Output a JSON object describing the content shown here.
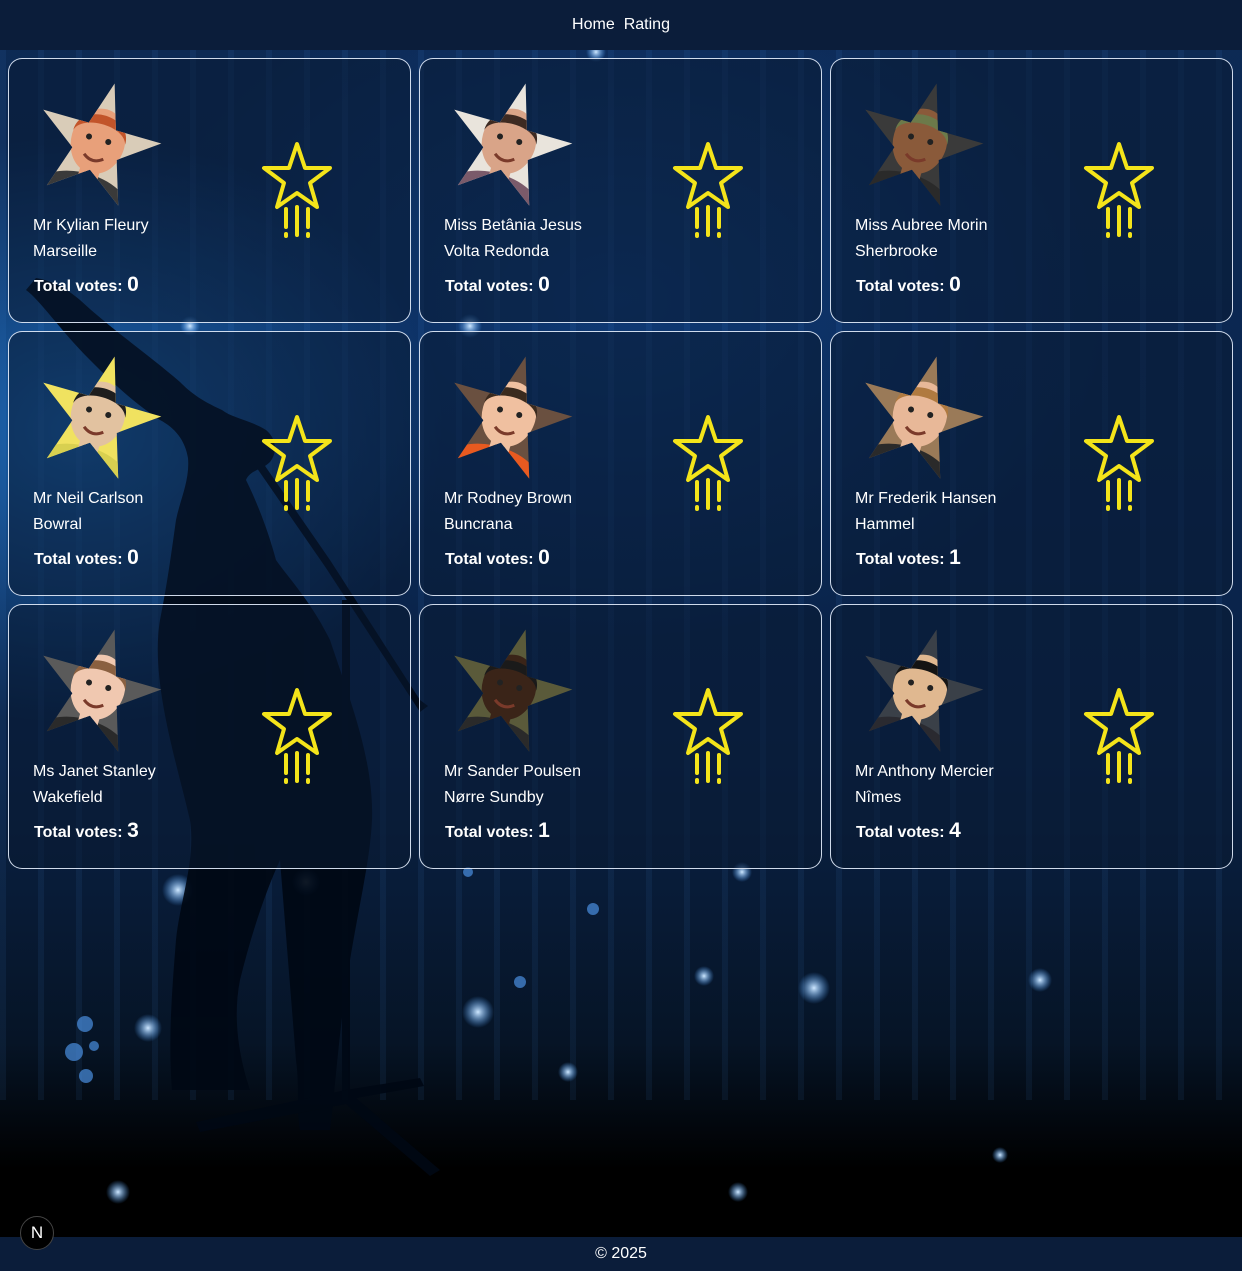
{
  "nav": {
    "home_label": "Home",
    "rating_label": "Rating"
  },
  "cards": [
    {
      "name": "Mr Kylian Fleury",
      "city": "Marseille",
      "votes_label": "Total votes:",
      "votes": "0",
      "avatar": {
        "bg": "#d9ccb8",
        "skin": "#e8a07a",
        "hair": "#c2542a",
        "shirt": "#3a3a3a"
      }
    },
    {
      "name": "Miss Betânia Jesus",
      "city": "Volta Redonda",
      "votes_label": "Total votes:",
      "votes": "0",
      "avatar": {
        "bg": "#e9e4dc",
        "skin": "#d9a488",
        "hair": "#3d2a22",
        "shirt": "#7a5a6a"
      }
    },
    {
      "name": "Miss Aubree Morin",
      "city": "Sherbrooke",
      "votes_label": "Total votes:",
      "votes": "0",
      "avatar": {
        "bg": "#3a3a3a",
        "skin": "#8a5a3a",
        "hair": "#6c7a4a",
        "shirt": "#2a2a2a"
      }
    },
    {
      "name": "Mr Neil Carlson",
      "city": "Bowral",
      "votes_label": "Total votes:",
      "votes": "0",
      "avatar": {
        "bg": "#f0e260",
        "skin": "#e2c2a0",
        "hair": "#1e1e1e",
        "shirt": "#d8d050"
      }
    },
    {
      "name": "Mr Rodney Brown",
      "city": "Buncrana",
      "votes_label": "Total votes:",
      "votes": "0",
      "avatar": {
        "bg": "#6a5040",
        "skin": "#f0c0a0",
        "hair": "#3a2a1e",
        "shirt": "#e85a20"
      }
    },
    {
      "name": "Mr Frederik Hansen",
      "city": "Hammel",
      "votes_label": "Total votes:",
      "votes": "1",
      "avatar": {
        "bg": "#9a7a58",
        "skin": "#e8b898",
        "hair": "#b07a40",
        "shirt": "#2a2a2a"
      }
    },
    {
      "name": "Ms Janet Stanley",
      "city": "Wakefield",
      "votes_label": "Total votes:",
      "votes": "3",
      "avatar": {
        "bg": "#5a5a5a",
        "skin": "#f0c8b0",
        "hair": "#8a6040",
        "shirt": "#2a2a2a"
      }
    },
    {
      "name": "Mr Sander Poulsen",
      "city": "Nørre Sundby",
      "votes_label": "Total votes:",
      "votes": "1",
      "avatar": {
        "bg": "#5a5a3a",
        "skin": "#3a2418",
        "hair": "#1a1a1a",
        "shirt": "#2a2a2a"
      }
    },
    {
      "name": "Mr Anthony Mercier",
      "city": "Nîmes",
      "votes_label": "Total votes:",
      "votes": "4",
      "avatar": {
        "bg": "#3a4048",
        "skin": "#e0b890",
        "hair": "#141414",
        "shirt": "#2a2a30"
      }
    }
  ],
  "star_icon_color": "#f4e41a",
  "footer": {
    "text": "© 2025"
  },
  "badge": {
    "letter": "N"
  }
}
